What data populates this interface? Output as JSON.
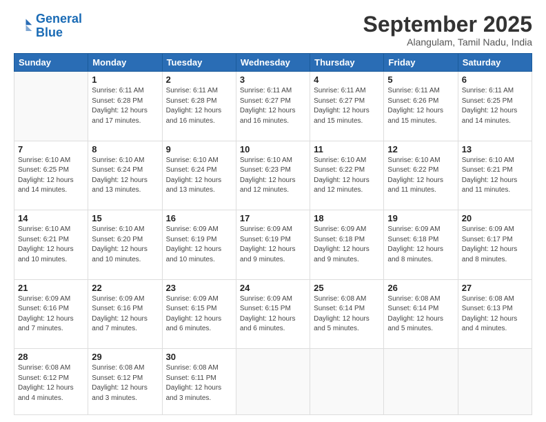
{
  "logo": {
    "line1": "General",
    "line2": "Blue"
  },
  "header": {
    "month": "September 2025",
    "location": "Alangulam, Tamil Nadu, India"
  },
  "days_of_week": [
    "Sunday",
    "Monday",
    "Tuesday",
    "Wednesday",
    "Thursday",
    "Friday",
    "Saturday"
  ],
  "weeks": [
    [
      {
        "day": "",
        "sunrise": "",
        "sunset": "",
        "daylight": ""
      },
      {
        "day": "1",
        "sunrise": "Sunrise: 6:11 AM",
        "sunset": "Sunset: 6:28 PM",
        "daylight": "Daylight: 12 hours and 17 minutes."
      },
      {
        "day": "2",
        "sunrise": "Sunrise: 6:11 AM",
        "sunset": "Sunset: 6:28 PM",
        "daylight": "Daylight: 12 hours and 16 minutes."
      },
      {
        "day": "3",
        "sunrise": "Sunrise: 6:11 AM",
        "sunset": "Sunset: 6:27 PM",
        "daylight": "Daylight: 12 hours and 16 minutes."
      },
      {
        "day": "4",
        "sunrise": "Sunrise: 6:11 AM",
        "sunset": "Sunset: 6:27 PM",
        "daylight": "Daylight: 12 hours and 15 minutes."
      },
      {
        "day": "5",
        "sunrise": "Sunrise: 6:11 AM",
        "sunset": "Sunset: 6:26 PM",
        "daylight": "Daylight: 12 hours and 15 minutes."
      },
      {
        "day": "6",
        "sunrise": "Sunrise: 6:11 AM",
        "sunset": "Sunset: 6:25 PM",
        "daylight": "Daylight: 12 hours and 14 minutes."
      }
    ],
    [
      {
        "day": "7",
        "sunrise": "Sunrise: 6:10 AM",
        "sunset": "Sunset: 6:25 PM",
        "daylight": "Daylight: 12 hours and 14 minutes."
      },
      {
        "day": "8",
        "sunrise": "Sunrise: 6:10 AM",
        "sunset": "Sunset: 6:24 PM",
        "daylight": "Daylight: 12 hours and 13 minutes."
      },
      {
        "day": "9",
        "sunrise": "Sunrise: 6:10 AM",
        "sunset": "Sunset: 6:24 PM",
        "daylight": "Daylight: 12 hours and 13 minutes."
      },
      {
        "day": "10",
        "sunrise": "Sunrise: 6:10 AM",
        "sunset": "Sunset: 6:23 PM",
        "daylight": "Daylight: 12 hours and 12 minutes."
      },
      {
        "day": "11",
        "sunrise": "Sunrise: 6:10 AM",
        "sunset": "Sunset: 6:22 PM",
        "daylight": "Daylight: 12 hours and 12 minutes."
      },
      {
        "day": "12",
        "sunrise": "Sunrise: 6:10 AM",
        "sunset": "Sunset: 6:22 PM",
        "daylight": "Daylight: 12 hours and 11 minutes."
      },
      {
        "day": "13",
        "sunrise": "Sunrise: 6:10 AM",
        "sunset": "Sunset: 6:21 PM",
        "daylight": "Daylight: 12 hours and 11 minutes."
      }
    ],
    [
      {
        "day": "14",
        "sunrise": "Sunrise: 6:10 AM",
        "sunset": "Sunset: 6:21 PM",
        "daylight": "Daylight: 12 hours and 10 minutes."
      },
      {
        "day": "15",
        "sunrise": "Sunrise: 6:10 AM",
        "sunset": "Sunset: 6:20 PM",
        "daylight": "Daylight: 12 hours and 10 minutes."
      },
      {
        "day": "16",
        "sunrise": "Sunrise: 6:09 AM",
        "sunset": "Sunset: 6:19 PM",
        "daylight": "Daylight: 12 hours and 10 minutes."
      },
      {
        "day": "17",
        "sunrise": "Sunrise: 6:09 AM",
        "sunset": "Sunset: 6:19 PM",
        "daylight": "Daylight: 12 hours and 9 minutes."
      },
      {
        "day": "18",
        "sunrise": "Sunrise: 6:09 AM",
        "sunset": "Sunset: 6:18 PM",
        "daylight": "Daylight: 12 hours and 9 minutes."
      },
      {
        "day": "19",
        "sunrise": "Sunrise: 6:09 AM",
        "sunset": "Sunset: 6:18 PM",
        "daylight": "Daylight: 12 hours and 8 minutes."
      },
      {
        "day": "20",
        "sunrise": "Sunrise: 6:09 AM",
        "sunset": "Sunset: 6:17 PM",
        "daylight": "Daylight: 12 hours and 8 minutes."
      }
    ],
    [
      {
        "day": "21",
        "sunrise": "Sunrise: 6:09 AM",
        "sunset": "Sunset: 6:16 PM",
        "daylight": "Daylight: 12 hours and 7 minutes."
      },
      {
        "day": "22",
        "sunrise": "Sunrise: 6:09 AM",
        "sunset": "Sunset: 6:16 PM",
        "daylight": "Daylight: 12 hours and 7 minutes."
      },
      {
        "day": "23",
        "sunrise": "Sunrise: 6:09 AM",
        "sunset": "Sunset: 6:15 PM",
        "daylight": "Daylight: 12 hours and 6 minutes."
      },
      {
        "day": "24",
        "sunrise": "Sunrise: 6:09 AM",
        "sunset": "Sunset: 6:15 PM",
        "daylight": "Daylight: 12 hours and 6 minutes."
      },
      {
        "day": "25",
        "sunrise": "Sunrise: 6:08 AM",
        "sunset": "Sunset: 6:14 PM",
        "daylight": "Daylight: 12 hours and 5 minutes."
      },
      {
        "day": "26",
        "sunrise": "Sunrise: 6:08 AM",
        "sunset": "Sunset: 6:14 PM",
        "daylight": "Daylight: 12 hours and 5 minutes."
      },
      {
        "day": "27",
        "sunrise": "Sunrise: 6:08 AM",
        "sunset": "Sunset: 6:13 PM",
        "daylight": "Daylight: 12 hours and 4 minutes."
      }
    ],
    [
      {
        "day": "28",
        "sunrise": "Sunrise: 6:08 AM",
        "sunset": "Sunset: 6:12 PM",
        "daylight": "Daylight: 12 hours and 4 minutes."
      },
      {
        "day": "29",
        "sunrise": "Sunrise: 6:08 AM",
        "sunset": "Sunset: 6:12 PM",
        "daylight": "Daylight: 12 hours and 3 minutes."
      },
      {
        "day": "30",
        "sunrise": "Sunrise: 6:08 AM",
        "sunset": "Sunset: 6:11 PM",
        "daylight": "Daylight: 12 hours and 3 minutes."
      },
      {
        "day": "",
        "sunrise": "",
        "sunset": "",
        "daylight": ""
      },
      {
        "day": "",
        "sunrise": "",
        "sunset": "",
        "daylight": ""
      },
      {
        "day": "",
        "sunrise": "",
        "sunset": "",
        "daylight": ""
      },
      {
        "day": "",
        "sunrise": "",
        "sunset": "",
        "daylight": ""
      }
    ]
  ]
}
